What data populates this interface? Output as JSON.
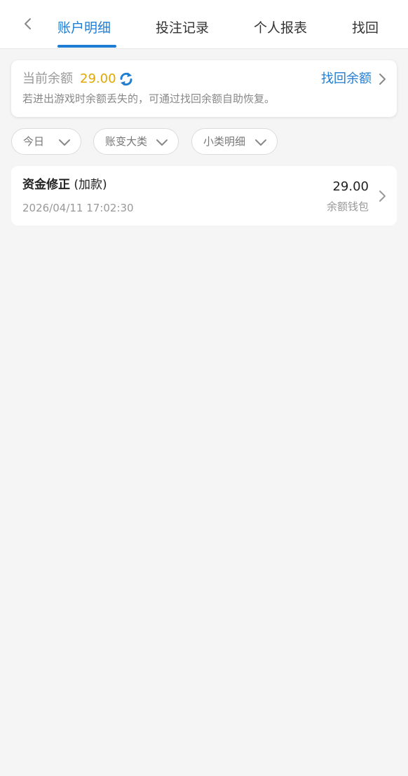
{
  "nav": {
    "back_icon": "chevron-left-icon",
    "tabs": [
      {
        "label": "账户明细",
        "active": true
      },
      {
        "label": "投注记录",
        "active": false
      },
      {
        "label": "个人报表",
        "active": false
      },
      {
        "label": "找回",
        "active": false
      }
    ]
  },
  "balance": {
    "label": "当前余额",
    "amount": "29.00",
    "refresh_icon": "refresh-icon",
    "recover_label": "找回余额",
    "note": "若进出游戏时余额丢失的，可通过找回余额自助恢复。"
  },
  "filters": [
    {
      "label": "今日"
    },
    {
      "label": "账变大类"
    },
    {
      "label": "小类明细"
    }
  ],
  "records": [
    {
      "title": "资金修正",
      "subtype": "(加款)",
      "time": "2026/04/11 17:02:30",
      "amount": "29.00",
      "wallet": "余额钱包"
    }
  ],
  "colors": {
    "accent": "#1f7dd4",
    "amount": "#e0a800",
    "background": "#f5f5f5"
  }
}
